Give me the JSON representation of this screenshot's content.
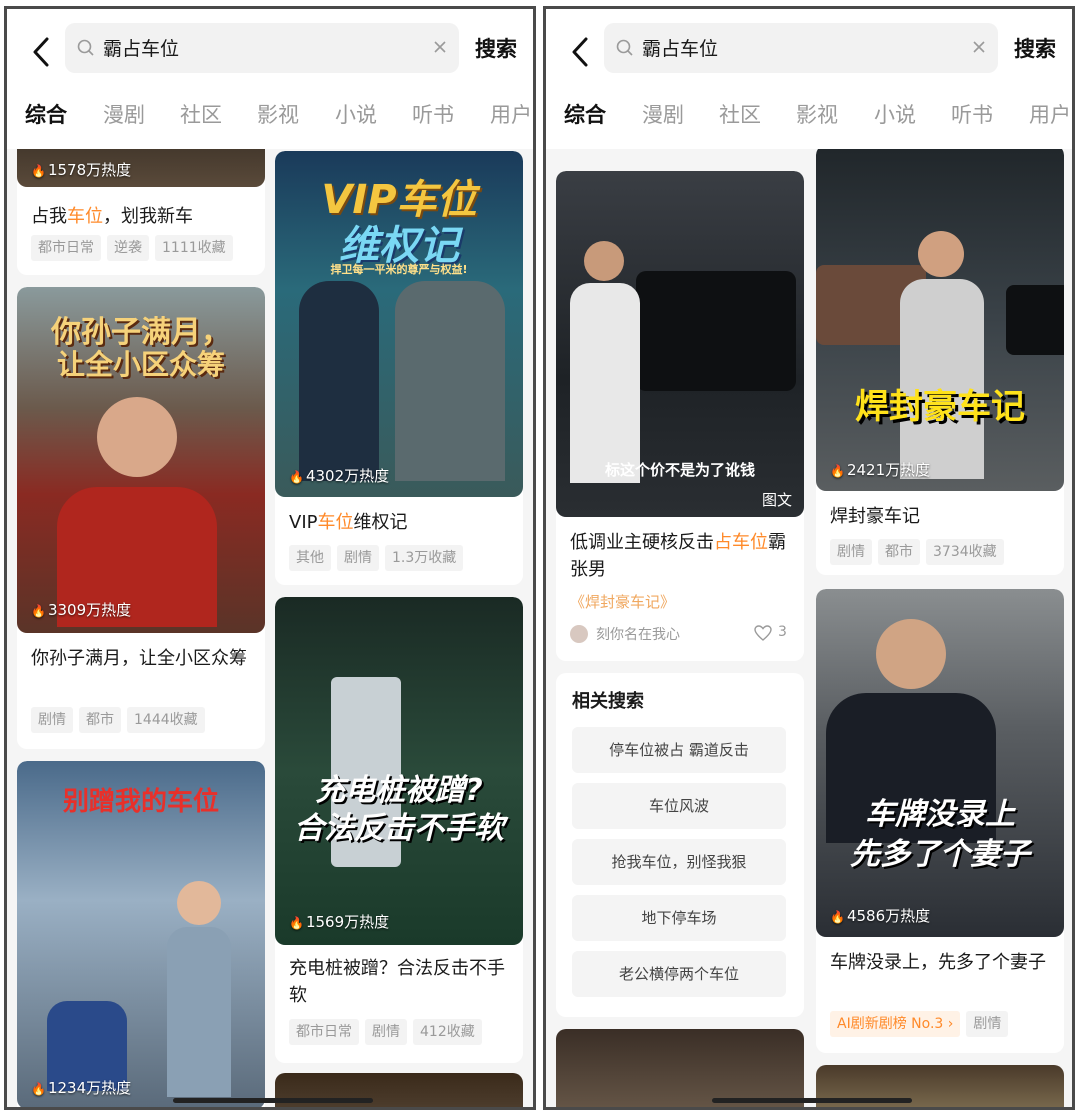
{
  "search": {
    "query": "霸占车位",
    "button_label": "搜索"
  },
  "tabs": [
    "综合",
    "漫剧",
    "社区",
    "影视",
    "小说",
    "听书",
    "用户"
  ],
  "left": {
    "card1": {
      "heat": "1578万热度",
      "title_pre": "占我",
      "title_hl": "车位",
      "title_post": "，划我新车",
      "tags": [
        "都市日常",
        "逆袭",
        "1111收藏"
      ]
    },
    "card2": {
      "poster": [
        "VIP车位",
        "维权记"
      ],
      "poster_sub": "捍卫每一平米的尊严与权益!",
      "heat": "4302万热度",
      "title_pre": "VIP",
      "title_hl": "车位",
      "title_post": "维权记",
      "tags": [
        "其他",
        "剧情",
        "1.3万收藏"
      ]
    },
    "card3": {
      "poster": [
        "你孙子满月，",
        "让全小区众筹"
      ],
      "heat": "3309万热度",
      "title": "你孙子满月，让全小区众筹",
      "tags": [
        "剧情",
        "都市",
        "1444收藏"
      ]
    },
    "card4": {
      "poster": [
        "充电桩被蹭?",
        "合法反击不手软"
      ],
      "heat": "1569万热度",
      "title": "充电桩被蹭？合法反击不手软",
      "tags": [
        "都市日常",
        "剧情",
        "412收藏"
      ]
    },
    "card5": {
      "poster": [
        "别蹭我的车位"
      ],
      "heat": "1234万热度"
    }
  },
  "right": {
    "card1": {
      "caption": "标这个价不是为了讹钱",
      "badge": "图文",
      "title_pre": "低调业主硬核反击",
      "title_hl": "占车位",
      "title_post": "霸张男",
      "link": "《焊封豪车记》",
      "author": "刻你名在我心",
      "likes": "3"
    },
    "card2": {
      "poster": [
        "焊封豪车记"
      ],
      "heat": "2421万热度",
      "title": "焊封豪车记",
      "tags": [
        "剧情",
        "都市",
        "3734收藏"
      ]
    },
    "related": {
      "heading": "相关搜索",
      "items": [
        "停车位被占 霸道反击",
        "车位风波",
        "抢我车位，别怪我狠",
        "地下停车场",
        "老公横停两个车位"
      ]
    },
    "card3": {
      "poster": [
        "车牌没录上",
        "先多了个妻子"
      ],
      "heat": "4586万热度",
      "title": "车牌没录上，先多了个妻子",
      "rank": "AI剧新剧榜 No.3 ›",
      "tags": [
        "剧情"
      ]
    }
  },
  "colors": {
    "accent": "#ff8a2a",
    "text": "#1a1a1a",
    "muted": "#9a9a9a"
  }
}
